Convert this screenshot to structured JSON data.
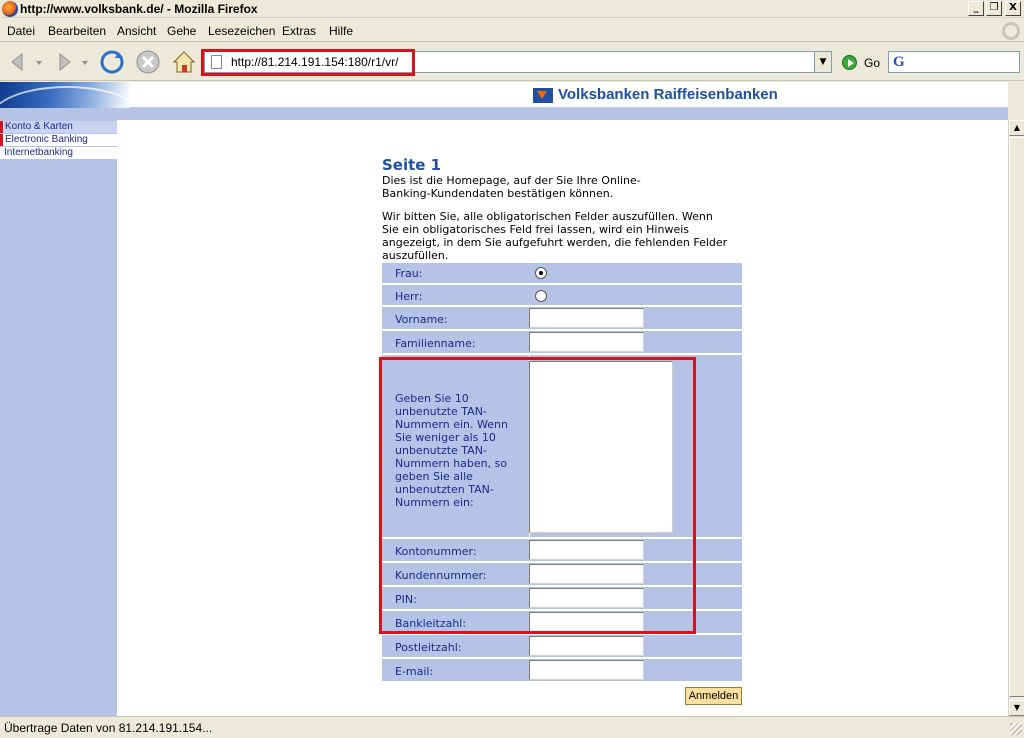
{
  "window": {
    "title": "http://www.volksbank.de/ - Mozilla Firefox",
    "min_label": "_",
    "max_label": "❐",
    "close_label": "X"
  },
  "menu": [
    "Datei",
    "Bearbeiten",
    "Ansicht",
    "Gehe",
    "Lesezeichen",
    "Extras",
    "Hilfe"
  ],
  "nav": {
    "url": "http://81.214.191.154:180/r1/vr/",
    "go_label": "Go",
    "dropdown_glyph": "▼",
    "search_glyph": "G"
  },
  "banner": {
    "brand": "Volksbanken Raiffeisenbanken"
  },
  "sidebar": {
    "items": [
      "Konto & Karten",
      "Electronic Banking",
      "Internetbanking"
    ]
  },
  "content": {
    "heading": "Seite 1",
    "intro": "Dies ist die Homepage, auf der Sie Ihre Online-Banking-Kundendaten bestätigen können.",
    "instructions": "Wir bitten Sie, alle obligatorischen Felder auszufüllen. Wenn Sie ein obligatorisches Feld frei lassen, wird ein Hinweis angezeigt, in dem Sie aufgefuhrt werden, die fehlenden Felder auszufüllen."
  },
  "form": {
    "frau_label": "Frau:",
    "herr_label": "Herr:",
    "selected_salutation": "Frau",
    "vorname_label": "Vorname:",
    "familienname_label": "Familienname:",
    "tan_label": "Geben Sie 10 unbenutzte TAN-Nummern ein. Wenn Sie weniger als 10 unbenutzte TAN-Nummern haben, so geben Sie alle unbenutzten TAN-Nummern ein:",
    "kontonummer_label": "Kontonummer:",
    "kundennummer_label": "Kundennummer:",
    "pin_label": "PIN:",
    "bankleitzahl_label": "Bankleitzahl:",
    "postleitzahl_label": "Postleitzahl:",
    "email_label": "E-mail:",
    "submit_label": "Anmelden"
  },
  "status": {
    "text": "Übertrage Daten von 81.214.191.154..."
  },
  "colors": {
    "form_bg": "#b4c3e6",
    "label_text": "#1a2a8a",
    "heading": "#1f4fa5",
    "highlight_box": "#d4141c"
  }
}
